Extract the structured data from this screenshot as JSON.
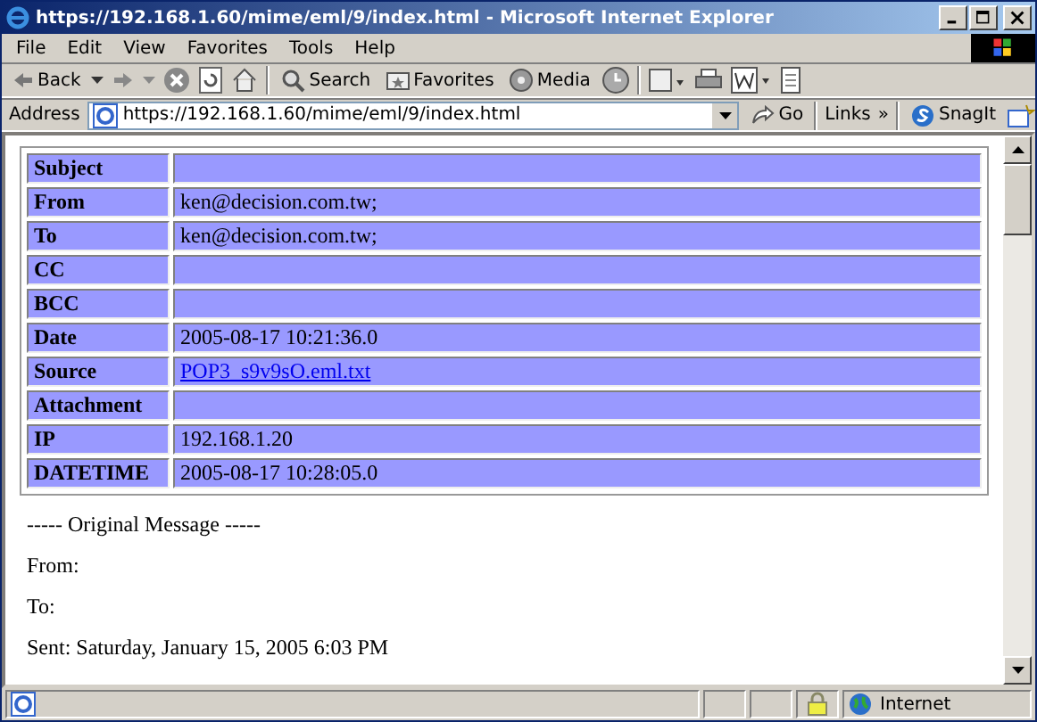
{
  "window": {
    "title": "https://192.168.1.60/mime/eml/9/index.html - Microsoft Internet Explorer"
  },
  "menu": [
    "File",
    "Edit",
    "View",
    "Favorites",
    "Tools",
    "Help"
  ],
  "toolbar": {
    "back": "Back",
    "search": "Search",
    "favorites": "Favorites",
    "media": "Media"
  },
  "address_bar": {
    "label": "Address",
    "value": "https://192.168.1.60/mime/eml/9/index.html",
    "go": "Go",
    "links": "Links",
    "links_more": "»",
    "snagit": "SnagIt"
  },
  "table": {
    "rows": [
      {
        "label": "Subject"
      },
      {
        "label": "From",
        "value": "ken@decision.com.tw;",
        "kind": "text"
      },
      {
        "label": "To",
        "value": "ken@decision.com.tw;",
        "kind": "text"
      },
      {
        "label": "CC"
      },
      {
        "label": "BCC"
      },
      {
        "label": "Date",
        "value": "2005-08-17 10:21:36.0",
        "kind": "text"
      },
      {
        "label": "Source",
        "value": "POP3_s9v9sO.eml.txt",
        "kind": "link"
      },
      {
        "label": "Attachment"
      },
      {
        "label": "IP",
        "value": "192.168.1.20",
        "kind": "text"
      },
      {
        "label": "DATETIME",
        "value": "2005-08-17 10:28:05.0",
        "kind": "text"
      }
    ]
  },
  "message_lines": [
    "----- Original Message -----",
    "From:",
    "To:",
    "Sent: Saturday, January 15, 2005 6:03 PM"
  ],
  "status_bar": {
    "zone": "Internet"
  }
}
